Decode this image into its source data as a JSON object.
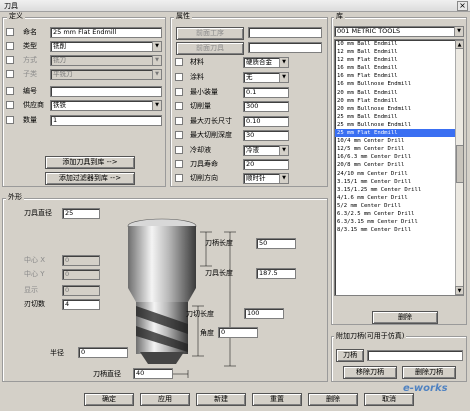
{
  "window": {
    "title": "刀具",
    "close_glyph": "×"
  },
  "definition": {
    "title": "定义",
    "rows": [
      {
        "label": "命名",
        "value": "25 mm Flat Endmill",
        "enabled": true
      },
      {
        "label": "类型",
        "value": "铣削",
        "enabled": true,
        "dropdown": true
      },
      {
        "label": "方式",
        "value": "铣刀",
        "enabled": false,
        "dropdown": true
      },
      {
        "label": "子类",
        "value": "平铣刀",
        "enabled": false,
        "dropdown": true
      },
      {
        "label": "编号",
        "value": "",
        "enabled": true
      },
      {
        "label": "供应商",
        "value": "铁铁",
        "enabled": true,
        "dropdown": true
      },
      {
        "label": "数量",
        "value": "1",
        "enabled": true
      }
    ],
    "add_to_library_button": "添加刀具到库 -->",
    "add_filter_button": "添加过滤器到库 -->"
  },
  "attributes": {
    "title": "属性",
    "prev_step_button": "前面工序",
    "prev_tool_button": "前面刀具",
    "rows": [
      {
        "label": "材料",
        "value": "硬质合金",
        "dropdown": true
      },
      {
        "label": "涂料",
        "value": "无",
        "dropdown": true
      },
      {
        "label": "最小装量",
        "value": "0.1"
      },
      {
        "label": "切削量",
        "value": "300"
      },
      {
        "label": "最大刃长尺寸",
        "value": "0.10"
      },
      {
        "label": "最大切削深度",
        "value": "30"
      },
      {
        "label": "冷却液",
        "value": "冷液",
        "dropdown": true
      },
      {
        "label": "刀具寿命",
        "value": "20"
      },
      {
        "label": "切削方向",
        "value": "顺时针",
        "dropdown": true
      }
    ]
  },
  "library": {
    "title": "库",
    "selected_library": "001 METRIC TOOLS",
    "items": [
      "10 mm Ball Endmill",
      "12 mm Ball Endmill",
      "12 mm Flat Endmill",
      "16 mm Ball Endmill",
      "16 mm Flat Endmill",
      "16 mm Bullnose Endmill",
      "20 mm Ball Endmill",
      "20 mm Flat Endmill",
      "20 mm Bullnose Endmill",
      "25 mm Ball Endmill",
      "25 mm Bullnose Endmill",
      "25 mm Flat Endmill",
      "10/4 mm Center Drill",
      "12/5 mm Center Drill",
      "16/6.3 mm Center Drill",
      "20/8 mm Center Drill",
      "24/10 mm Center Drill",
      "3.15/1 mm Center Drill",
      "3.15/1.25 mm Center Drill",
      "4/1.6 mm Center Drill",
      "5/2 mm Center Drill",
      "6.3/2.5 mm Center Drill",
      "6.3/3.15 mm Center Drill",
      "8/3.15 mm Center Drill"
    ],
    "selected_index": 11,
    "delete_button": "删除"
  },
  "holder": {
    "title": "附加刀柄(可用于仿真)",
    "holder_button": "刀柄",
    "remove_holder_button": "移除刀柄",
    "delete_holder_button": "删除刀柄"
  },
  "shape": {
    "title": "外形",
    "rows": [
      {
        "label": "刀具直径",
        "value": "25",
        "enabled": true
      },
      {
        "label": "中心 X",
        "value": "0",
        "enabled": false
      },
      {
        "label": "中心 Y",
        "value": "0",
        "enabled": false
      },
      {
        "label": "显示",
        "value": "0",
        "enabled": false
      },
      {
        "label": "刃切数",
        "value": "4",
        "enabled": true
      }
    ],
    "radius_label": "半径",
    "radius_value": "0",
    "diag_labels": {
      "tool_length": "刀柄长度",
      "tool_length_value": "50",
      "overall_length": "刀具长度",
      "overall_length_value": "187.5",
      "flute_length": "刀切长度",
      "flute_length_value": "100",
      "angle": "角度",
      "angle_value": "0",
      "shank_diameter": "刀柄直径",
      "shank_diameter_value": "40"
    }
  },
  "footer": {
    "ok": "确定",
    "apply": "应用",
    "cancel_edit": "新建",
    "reset": "重置",
    "delete": "删除",
    "close": "取消"
  },
  "watermark": "e-works"
}
